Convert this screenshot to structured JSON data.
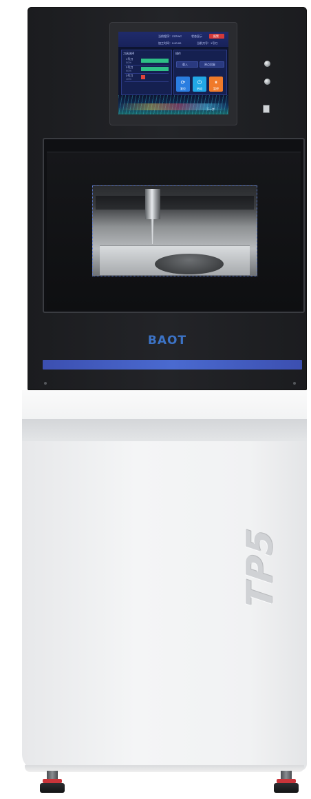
{
  "brand": {
    "logo_text": "BAOT",
    "accent_color": "#3c73c6",
    "stripe_color": "#4a6ad0"
  },
  "model": {
    "label": "TP5"
  },
  "control_screen": {
    "header": {
      "program_label": "当前程序：ZZZ/NC",
      "status_label": "状态显示",
      "alarm_label": "报警",
      "time_label": "加工时间：0:00:00",
      "tool_label": "当前刀号：1号刀"
    },
    "tool_panel": {
      "title": "刀具选择",
      "tools": [
        {
          "name": "1号刀",
          "sub": "50%",
          "level": 0.75,
          "status": "ok"
        },
        {
          "name": "2号刀",
          "sub": "90%",
          "level": 0.75,
          "status": "ok"
        },
        {
          "name": "3号刀",
          "sub": "10%",
          "level": 0.12,
          "status": "low"
        }
      ]
    },
    "operations_panel": {
      "title": "操作",
      "load_label": "载入",
      "origin_label": "原点回复",
      "buttons": [
        {
          "label": "复位",
          "color": "#2a7de0",
          "icon": "refresh-icon"
        },
        {
          "label": "启动",
          "color": "#22a7e6",
          "icon": "power-icon"
        },
        {
          "label": "暂停",
          "color": "#f07a2a",
          "icon": "pause-icon"
        }
      ],
      "next_label": "下一步"
    }
  }
}
